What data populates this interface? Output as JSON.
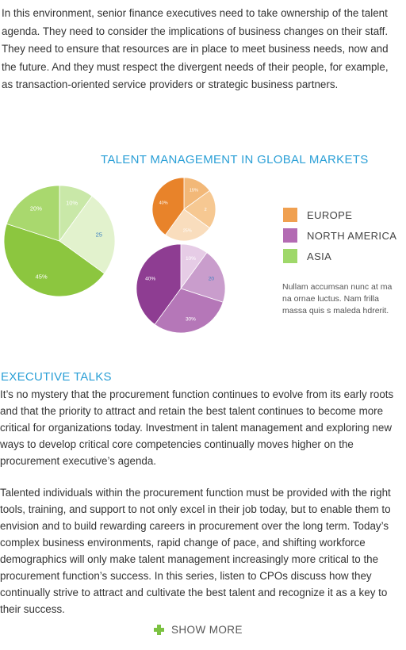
{
  "intro_lines": [
    "In this environment, senior finance executives need to take ownership of the talent",
    "agenda. They need to consider the implications of business changes on their staff.",
    "They need to ensure that resources are in place to meet business needs, now and",
    "the future. And they must respect the divergent needs of their people, for example,",
    "as transaction-oriented service providers or strategic business partners."
  ],
  "chart_data": {
    "type": "pie",
    "title": "TALENT MANAGEMENT IN GLOBAL MARKETS",
    "legend": [
      {
        "label": "EUROPE",
        "color": "#f0a050"
      },
      {
        "label": "NORTH AMERICA",
        "color": "#b36bb3"
      },
      {
        "label": "ASIA",
        "color": "#9fd86a"
      }
    ],
    "pies": [
      {
        "region": "ASIA",
        "slices": [
          {
            "label": "10%",
            "value": 10,
            "color": "#c9e8a8"
          },
          {
            "label": "25",
            "value": 25,
            "color": "#e2f2cd"
          },
          {
            "label": "45%",
            "value": 45,
            "color": "#8cc63f"
          },
          {
            "label": "20%",
            "value": 20,
            "color": "#a9d86e"
          }
        ]
      },
      {
        "region": "EUROPE",
        "slices": [
          {
            "label": "15%",
            "value": 15,
            "color": "#f2b878"
          },
          {
            "label": "2",
            "value": 20,
            "color": "#f6c892"
          },
          {
            "label": "25%",
            "value": 25,
            "color": "#f9ddbd"
          },
          {
            "label": "40%",
            "value": 40,
            "color": "#e8832a"
          }
        ]
      },
      {
        "region": "NORTH AMERICA",
        "slices": [
          {
            "label": "10%",
            "value": 10,
            "color": "#e6cce6"
          },
          {
            "label": "20",
            "value": 20,
            "color": "#c99dcc"
          },
          {
            "label": "30%",
            "value": 30,
            "color": "#b577b8"
          },
          {
            "label": "40%",
            "value": 40,
            "color": "#8e3d92"
          }
        ]
      }
    ]
  },
  "side_note_lines": [
    "Nullam accumsan nunc at ma",
    "na ornae luctus. Nam frilla",
    "massa quis s maleda hdrerit."
  ],
  "section_title": "EXECUTIVE TALKS",
  "paragraph1": [
    "It’s no mystery that the procurement function continues to evolve from its early roots",
    "and that the priority to attract and retain the best talent continues to become more",
    "critical for organizations today. Investment in talent management and exploring new",
    "ways to develop critical core competencies continually moves higher on the",
    "procurement executive’s agenda."
  ],
  "paragraph2": [
    "Talented individuals within the procurement function must be provided with the right",
    "tools, training, and support to not only excel in their job today, but to enable them to",
    "envision and to build rewarding careers in procurement over the long term. Today’s",
    "complex business environments, rapid change of pace, and shifting workforce",
    "demographics will only make talent management increasingly more critical to the",
    "procurement function’s success. In this series, listen to CPOs discuss how they",
    "continually strive to attract and cultivate the best talent and recognize it as a key to",
    "their success."
  ],
  "show_more_label": "SHOW MORE"
}
